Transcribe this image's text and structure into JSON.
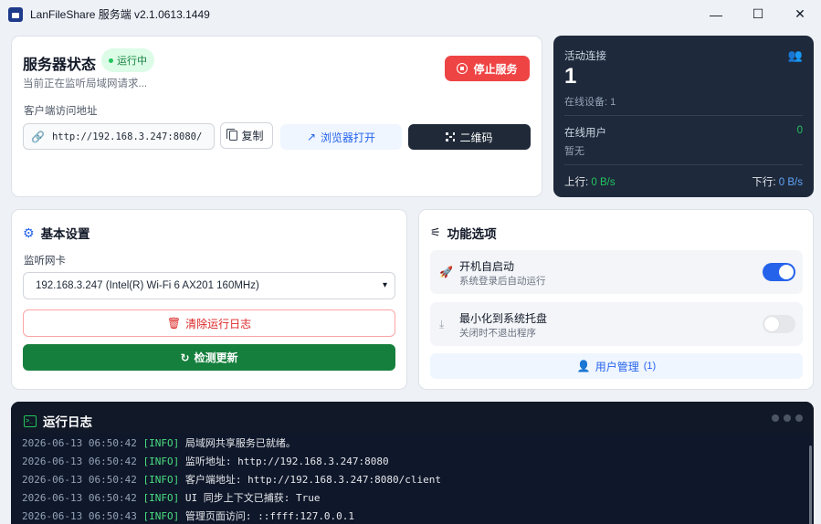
{
  "window": {
    "title": "LanFileShare 服务端 v2.1.0613.1449",
    "minimize": "—",
    "maximize": "☐",
    "close": "✕"
  },
  "status": {
    "title": "服务器状态",
    "badge": "运行中",
    "subtitle": "当前正在监听局域网请求...",
    "stop_label": "停止服务",
    "address_label": "客户端访问地址",
    "address": "http://192.168.3.247:8080/",
    "copy_label": "复制",
    "browser_label": "浏览器打开",
    "qr_label": "二维码"
  },
  "connections": {
    "label": "活动连接",
    "count": "1",
    "online_devices": "在线设备: 1",
    "online_users_label": "在线用户",
    "online_users_count": "0",
    "none_text": "暂无",
    "upload_label": "上行: ",
    "upload_value": "0 B/s",
    "download_label": "下行: ",
    "download_value": "0 B/s"
  },
  "basic": {
    "title": "基本设置",
    "nic_label": "监听网卡",
    "nic_selected": "192.168.3.247 (Intel(R) Wi-Fi 6 AX201 160MHz)",
    "clear_label": "清除运行日志",
    "update_label": "检测更新"
  },
  "features": {
    "title": "功能选项",
    "items": [
      {
        "title": "开机自启动",
        "desc": "系统登录后自动运行",
        "enabled": true
      },
      {
        "title": "最小化到系统托盘",
        "desc": "关闭时不退出程序",
        "enabled": false
      }
    ],
    "user_mgmt_label": "用户管理",
    "user_mgmt_count": "(1)"
  },
  "log": {
    "title": "运行日志",
    "lines": [
      {
        "time": "2026-06-13 06:50:42",
        "level": "[INFO]",
        "msg": "局域网共享服务已就绪。"
      },
      {
        "time": "2026-06-13 06:50:42",
        "level": "[INFO]",
        "msg": "监听地址: http://192.168.3.247:8080"
      },
      {
        "time": "2026-06-13 06:50:42",
        "level": "[INFO]",
        "msg": "客户端地址: http://192.168.3.247:8080/client"
      },
      {
        "time": "2026-06-13 06:50:42",
        "level": "[INFO]",
        "msg": "UI 同步上下文已捕获: True"
      },
      {
        "time": "2026-06-13 06:50:43",
        "level": "[INFO]",
        "msg": "管理页面访问: ::ffff:127.0.0.1"
      }
    ]
  },
  "colors": {
    "accent": "#2563eb",
    "danger": "#ef4444",
    "success": "#15803d",
    "dark_panel": "#1e293b"
  }
}
